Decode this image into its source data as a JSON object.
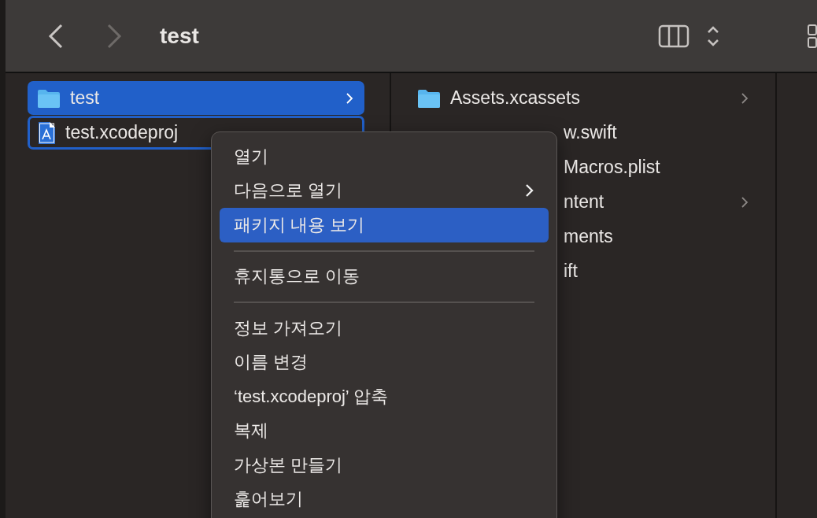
{
  "toolbar": {
    "back": {
      "disabled": false
    },
    "forward": {
      "disabled": true
    },
    "title": "test"
  },
  "columns": [
    {
      "items": [
        {
          "name": "test",
          "kind": "folder",
          "selected": true,
          "focused": false,
          "has_children": true,
          "covered": false
        },
        {
          "name": "test.xcodeproj",
          "kind": "project",
          "selected": false,
          "focused": true,
          "has_children": false,
          "covered": false
        }
      ]
    },
    {
      "items": [
        {
          "name": "Assets.xcassets",
          "kind": "folder",
          "selected": false,
          "focused": false,
          "has_children": true,
          "covered": false
        },
        {
          "name": "w.swift",
          "kind": "file",
          "selected": false,
          "focused": false,
          "has_children": false,
          "covered": true
        },
        {
          "name": "Macros.plist",
          "kind": "file",
          "selected": false,
          "focused": false,
          "has_children": false,
          "covered": true
        },
        {
          "name": "ntent",
          "kind": "file",
          "selected": false,
          "focused": false,
          "has_children": true,
          "covered": true
        },
        {
          "name": "ments",
          "kind": "file",
          "selected": false,
          "focused": false,
          "has_children": false,
          "covered": true
        },
        {
          "name": "ift",
          "kind": "file",
          "selected": false,
          "focused": false,
          "has_children": false,
          "covered": true
        }
      ]
    }
  ],
  "context_menu": [
    {
      "kind": "item",
      "label": "열기",
      "selected": false,
      "submenu": false
    },
    {
      "kind": "item",
      "label": "다음으로 열기",
      "selected": false,
      "submenu": true
    },
    {
      "kind": "item",
      "label": "패키지 내용 보기",
      "selected": true,
      "submenu": false
    },
    {
      "kind": "separator"
    },
    {
      "kind": "item",
      "label": "휴지통으로 이동",
      "selected": false,
      "submenu": false
    },
    {
      "kind": "separator"
    },
    {
      "kind": "item",
      "label": "정보 가져오기",
      "selected": false,
      "submenu": false
    },
    {
      "kind": "item",
      "label": "이름 변경",
      "selected": false,
      "submenu": false
    },
    {
      "kind": "item",
      "label": "‘test.xcodeproj’ 압축",
      "selected": false,
      "submenu": false
    },
    {
      "kind": "item",
      "label": "복제",
      "selected": false,
      "submenu": false
    },
    {
      "kind": "item",
      "label": "가상본 만들기",
      "selected": false,
      "submenu": false
    },
    {
      "kind": "item",
      "label": "훑어보기",
      "selected": false,
      "submenu": false
    }
  ]
}
